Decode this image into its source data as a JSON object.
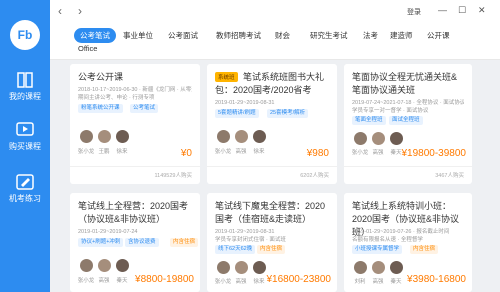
{
  "sidebar": {
    "logo": "Fb",
    "items": [
      {
        "label": "我的课程",
        "icon": "book-icon"
      },
      {
        "label": "购买课程",
        "icon": "play-icon"
      },
      {
        "label": "机考练习",
        "icon": "pencil-icon"
      }
    ]
  },
  "topbar": {
    "back": "‹",
    "forward": "›",
    "login": "登录",
    "minimize": "—",
    "maximize": "☐",
    "close": "✕"
  },
  "tabs": [
    "公考笔试",
    "事业单位",
    "公考面试",
    "教师招聘考试",
    "财会",
    "研究生考试",
    "法考",
    "建造师",
    "公开课",
    "Office"
  ],
  "active_tab": 0,
  "cards": [
    {
      "title": "公考公开课",
      "sub1": "2018-10-17~2019-06-30 · 新疆《龙门网 · 从零开始》",
      "sub2": "期间主讲公考、申论 · 行测专项",
      "tags": [
        "粉笔系统公开课",
        "公考笔试"
      ],
      "teachers": [
        "张小龙",
        "王鹏",
        "徐来"
      ],
      "price": "¥0",
      "count": "1149529人购买"
    },
    {
      "title": "笔试系统班图书大礼包：2020国考/2020省考",
      "badge": "系统班",
      "sub1": "2019-01-29~2019-08-31",
      "tags": [
        "5套题精讲/刷题",
        "25套模考/解析"
      ],
      "teachers": [
        "张小龙",
        "高强",
        "徐来"
      ],
      "price": "¥980",
      "count": "6202人购买"
    },
    {
      "title": "笔面协议全程无忧通关班&笔面协议通关班",
      "sub1": "2019-07-24~2021-07-18 · 全程协议 · 面试协议",
      "sub2": "学员专享一对一督学 · 面试协议",
      "tags": [
        "笔面全程班",
        "面试全程班"
      ],
      "teachers": [
        "张小龙",
        "高强",
        "秦天"
      ],
      "price": "¥19800-39800",
      "count": "3467人购买"
    },
    {
      "title": "笔试线上全程营：2020国考（协议班&非协议班）",
      "sub1": "2019-01-29~2019-07-24",
      "tags": [
        "协议+刷题+冲刺",
        "含协议退费",
        "内含住宿"
      ],
      "teachers": [
        "张小龙",
        "高强",
        "秦天"
      ],
      "price": "¥8800-19800",
      "count": ""
    },
    {
      "title": "笔试线下魔鬼全程营：2020国考（佳宿班&走读班）",
      "sub1": "2019-01-29~2019-08-31",
      "sub2": "学员专享封闭式住宿 · 面试班",
      "tags": [
        "线下62天62晚",
        "内含住宿"
      ],
      "teachers": [
        "张小龙",
        "高强",
        "徐来"
      ],
      "price": "¥16800-23800",
      "count": ""
    },
    {
      "title": "笔试线上系统特训小班：2020国考（协议班&非协议班）",
      "sub1": "2019-01-29~2019-07-26 · 报名截止时间",
      "sub2": "名额有限报名从速 · 全程督学",
      "tags": [
        "小班授课专属督学",
        "内含住宿"
      ],
      "teachers": [
        "刘利",
        "高强",
        "秦天"
      ],
      "price": "¥3980-16800",
      "count": ""
    }
  ]
}
